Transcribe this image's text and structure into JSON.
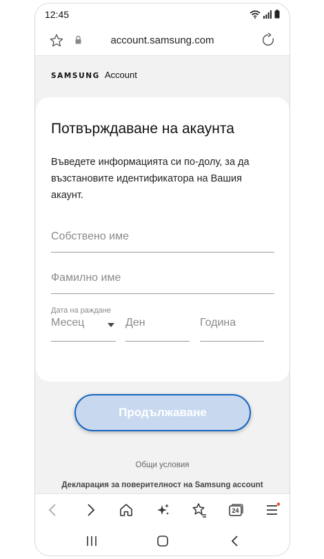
{
  "status_bar": {
    "time": "12:45"
  },
  "browser": {
    "url": "account.samsung.com"
  },
  "brand": {
    "name": "SAMSUNG",
    "product": "Account"
  },
  "form": {
    "title": "Потвърждаване на акаунта",
    "description": "Въведете информацията си по-долу, за да възстановите идентификатора на Вашия акаунт.",
    "first_name_placeholder": "Собствено име",
    "last_name_placeholder": "Фамилно име",
    "birthdate_label": "Дата на раждане",
    "month_placeholder": "Месец",
    "day_placeholder": "Ден",
    "year_placeholder": "Година",
    "continue_label": "Продължаване"
  },
  "footer": {
    "terms": "Общи условия",
    "privacy": "Декларация за поверителност на Samsung account"
  },
  "toolbar": {
    "tabs_count": "24"
  },
  "colors": {
    "accent": "#1565c0",
    "button_fill": "#c7d8ef",
    "notification_dot": "#e8531f"
  }
}
